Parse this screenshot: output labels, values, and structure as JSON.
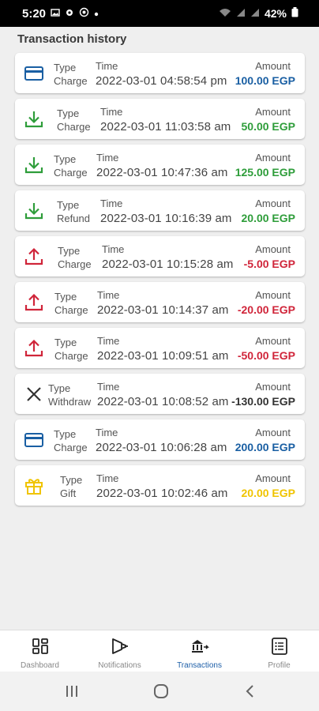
{
  "status_bar": {
    "time": "5:20",
    "battery": "42%",
    "left_icons": [
      "image-icon",
      "gear-icon",
      "whatsapp-icon",
      "dot-icon"
    ],
    "right_icons": [
      "wifi-icon",
      "signal-icon",
      "signal-icon",
      "battery-icon"
    ]
  },
  "page": {
    "title": "Transaction history"
  },
  "colors": {
    "positive": "#2e9d3a",
    "negative": "#d0253a",
    "charge_blue": "#1a5fa3",
    "neutral": "#333333",
    "gift": "#f0c400"
  },
  "transactions": [
    {
      "icon": "credit-card-icon",
      "type_label": "Type",
      "type": "Charge",
      "time_label": "Time",
      "time": "2022-03-01 04:58:54 pm",
      "amount_label": "Amount",
      "amount": "100.00 EGP",
      "amount_color": "#1a5fa3"
    },
    {
      "icon": "download-icon",
      "type_label": "Type",
      "type": "Charge",
      "time_label": "Time",
      "time": "2022-03-01 11:03:58 am",
      "amount_label": "Amount",
      "amount": "50.00 EGP",
      "amount_color": "#2e9d3a"
    },
    {
      "icon": "download-icon",
      "type_label": "Type",
      "type": "Charge",
      "time_label": "Time",
      "time": "2022-03-01 10:47:36 am",
      "amount_label": "Amount",
      "amount": "125.00 EGP",
      "amount_color": "#2e9d3a"
    },
    {
      "icon": "download-icon",
      "type_label": "Type",
      "type": "Refund",
      "time_label": "Time",
      "time": "2022-03-01 10:16:39 am",
      "amount_label": "Amount",
      "amount": "20.00 EGP",
      "amount_color": "#2e9d3a"
    },
    {
      "icon": "upload-icon",
      "type_label": "Type",
      "type": "Charge",
      "time_label": "Time",
      "time": "2022-03-01 10:15:28 am",
      "amount_label": "Amount",
      "amount": "-5.00 EGP",
      "amount_color": "#d0253a"
    },
    {
      "icon": "upload-icon",
      "type_label": "Type",
      "type": "Charge",
      "time_label": "Time",
      "time": "2022-03-01 10:14:37 am",
      "amount_label": "Amount",
      "amount": "-20.00 EGP",
      "amount_color": "#d0253a"
    },
    {
      "icon": "upload-icon",
      "type_label": "Type",
      "type": "Charge",
      "time_label": "Time",
      "time": "2022-03-01 10:09:51 am",
      "amount_label": "Amount",
      "amount": "-50.00 EGP",
      "amount_color": "#d0253a"
    },
    {
      "icon": "close-icon",
      "type_label": "Type",
      "type": "Withdraw",
      "time_label": "Time",
      "time": "2022-03-01 10:08:52 am",
      "amount_label": "Amount",
      "amount": "-130.00 EGP",
      "amount_color": "#333333"
    },
    {
      "icon": "credit-card-icon",
      "type_label": "Type",
      "type": "Charge",
      "time_label": "Time",
      "time": "2022-03-01 10:06:28 am",
      "amount_label": "Amount",
      "amount": "200.00 EGP",
      "amount_color": "#1a5fa3"
    },
    {
      "icon": "gift-icon",
      "type_label": "Type",
      "type": "Gift",
      "time_label": "Time",
      "time": "2022-03-01 10:02:46 am",
      "amount_label": "Amount",
      "amount": "20.00 EGP",
      "amount_color": "#f0c400"
    }
  ],
  "bottom_nav": [
    {
      "id": "dashboard",
      "icon": "dashboard-icon",
      "label": "Dashboard",
      "active": false
    },
    {
      "id": "notifications",
      "icon": "megaphone-icon",
      "label": "Notifications",
      "active": false
    },
    {
      "id": "transactions",
      "icon": "bank-transfer-icon",
      "label": "Transactions",
      "active": true
    },
    {
      "id": "profile",
      "icon": "profile-list-icon",
      "label": "Profile",
      "active": false
    }
  ],
  "system_nav": [
    "recent-apps-icon",
    "home-icon",
    "back-icon"
  ]
}
